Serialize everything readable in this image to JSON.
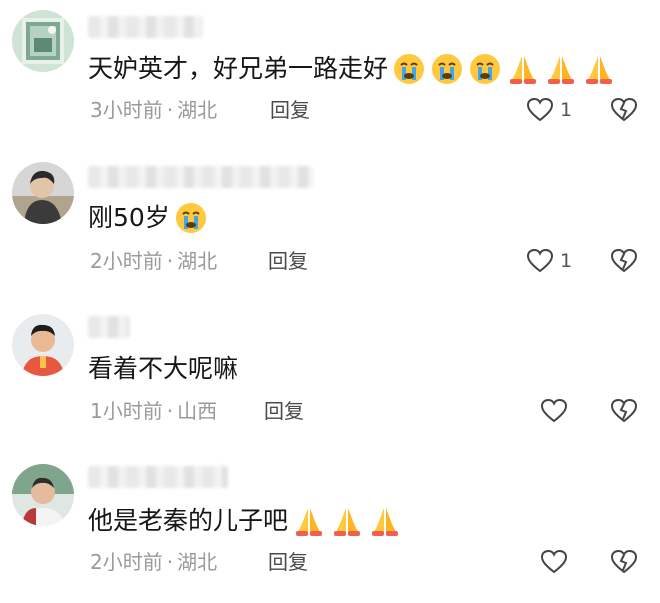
{
  "comments": [
    {
      "text": "天妒英才，好兄弟一路走好",
      "emojis": [
        "crying-face",
        "crying-face",
        "crying-face",
        "folded-hands",
        "folded-hands",
        "folded-hands"
      ],
      "time": "3小时前",
      "location": "湖北",
      "reply_label": "回复",
      "like_count": "1"
    },
    {
      "text": "刚50岁",
      "emojis": [
        "crying-face"
      ],
      "time": "2小时前",
      "location": "湖北",
      "reply_label": "回复",
      "like_count": "1"
    },
    {
      "text": "看着不大呢嘛",
      "emojis": [],
      "time": "1小时前",
      "location": "山西",
      "reply_label": "回复",
      "like_count": ""
    },
    {
      "text": "他是老秦的儿子吧",
      "emojis": [
        "folded-hands",
        "folded-hands",
        "folded-hands"
      ],
      "time": "2小时前",
      "location": "湖北",
      "reply_label": "回复",
      "like_count": ""
    }
  ],
  "separator": "·",
  "icons": {
    "like": "heart-outline-icon",
    "dislike": "broken-heart-icon"
  },
  "colors": {
    "meta_text": "#9a9a9a",
    "reply_text": "#4a4a4a",
    "emoji_yellow": "#ffc83d"
  }
}
